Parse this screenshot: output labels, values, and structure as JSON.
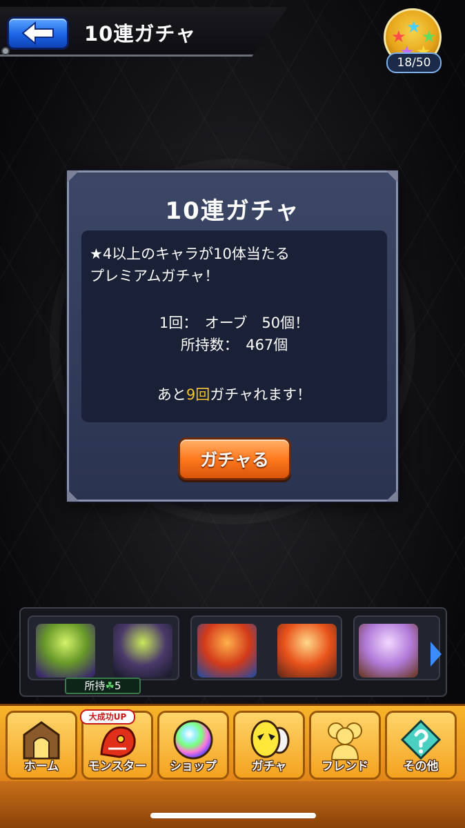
{
  "header": {
    "title": "10連ガチャ",
    "back_icon": "back-arrow-icon"
  },
  "rank": {
    "label": "18/50"
  },
  "dialog": {
    "title": "10連ガチャ",
    "desc_line1": "★4以上のキャラが10体当たる",
    "desc_line2": "プレミアムガチャ！",
    "cost_line": "1回：　オーブ　50個！",
    "owned_line": "所持数：　467個",
    "remain_prefix": "あと",
    "remain_count": "9回",
    "remain_suffix": "ガチャれます！",
    "button_label": "ガチャる"
  },
  "party": {
    "owned_badge_label": "所持",
    "owned_badge_icon": "☘",
    "owned_badge_count": "5"
  },
  "nav": {
    "items": [
      {
        "label": "ホーム",
        "icon": "home-gate-icon"
      },
      {
        "label": "モンスター",
        "icon": "dragon-icon"
      },
      {
        "label": "ショップ",
        "icon": "orb-icon"
      },
      {
        "label": "ガチャ",
        "icon": "egg-icon"
      },
      {
        "label": "フレンド",
        "icon": "friends-icon"
      },
      {
        "label": "その他",
        "icon": "other-icon"
      }
    ],
    "badge": "大成功UP"
  },
  "colors": {
    "accent": "#f4c430",
    "button_orange": "#ff7a1e",
    "back_blue": "#1c64e6",
    "nav_orange": "#f7b52a"
  }
}
